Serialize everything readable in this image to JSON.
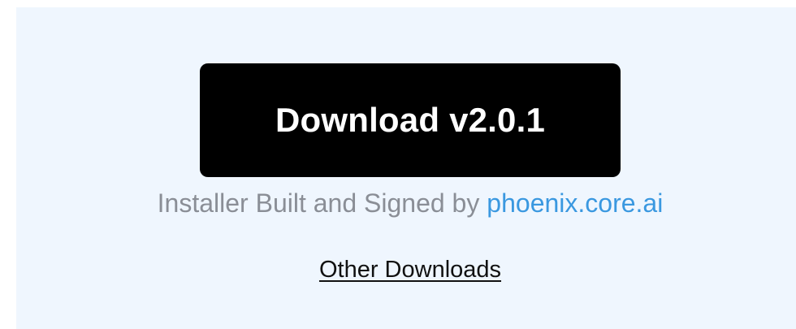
{
  "download": {
    "button_label": "Download v2.0.1"
  },
  "installer": {
    "prefix_text": "Installer Built and Signed by",
    "link_text": "phoenix.core.ai"
  },
  "other_downloads": {
    "link_text": "Other Downloads"
  },
  "colors": {
    "panel_background": "#eff6fe",
    "button_background": "#000000",
    "button_text": "#ffffff",
    "muted_text": "#8a8e96",
    "link_accent": "#3a98e0"
  }
}
